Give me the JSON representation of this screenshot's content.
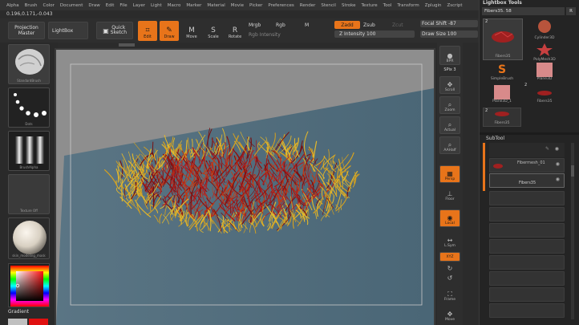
{
  "menu": [
    "Alpha",
    "Brush",
    "Color",
    "Document",
    "Draw",
    "Edit",
    "File",
    "Layer",
    "Light",
    "Macro",
    "Marker",
    "Material",
    "Movie",
    "Picker",
    "Preferences",
    "Render",
    "Stencil",
    "Stroke",
    "Texture",
    "Tool",
    "Transform",
    "Zplugin",
    "Zscript"
  ],
  "coords": "0.196,0.171,-0.043",
  "toolbar": {
    "projection_master": "Projection Master",
    "lightbox": "LightBox",
    "quick_sketch": "Quick Sketch",
    "edit": "Edit",
    "draw": "Draw",
    "move": "Move",
    "scale": "Scale",
    "rotate": "Rotate",
    "mrgb": "Mrgb",
    "rgb": "Rgb",
    "m": "M",
    "rgb_intensity": "Rgb Intensity",
    "zadd": "Zadd",
    "zsub": "Zsub",
    "zcut": "Zcut",
    "z_intensity": "Z Intensity 100",
    "focal_shift": "Focal Shift -87",
    "draw_size": "Draw Size 100"
  },
  "left": {
    "brush_caption": "StandardBrush",
    "stroke_caption": "Dots",
    "alpha_caption": "BrushAlpha",
    "texture_caption": "Texture Off",
    "material_caption": "skin_modeling_mask",
    "gradient": "Gradient"
  },
  "shelf": {
    "bpr": "BPR",
    "spix": "SPix 3",
    "scroll": "Scroll",
    "zoom": "Zoom",
    "actual": "Actual",
    "aahalf": "AAHalf",
    "persp": "Persp",
    "floor": "Floor",
    "local": "Local",
    "lsym": "L.Sym",
    "xyz": "XYZ",
    "frame": "Frame",
    "move": "Move"
  },
  "rightpanel": {
    "title": "Lightbox Tools",
    "current_tool": "Fibers35. 58",
    "r": "R",
    "tools": [
      "Fibers35",
      "Cylinder3D",
      "PolyMesh3D",
      "SimpleBrush",
      "Plane3D",
      "Plane3D_1",
      "Fibers35",
      "Fibers35"
    ],
    "badge_2a": "2",
    "badge_2b": "2",
    "badge_2c": "2",
    "subtool_title": "SubTool",
    "subtools": [
      "Fibermesh_01",
      "Fibers35"
    ]
  },
  "colors": {
    "accent": "#e8741a",
    "viewport": "#8e8e8e",
    "plane": "#4f6b7c"
  }
}
